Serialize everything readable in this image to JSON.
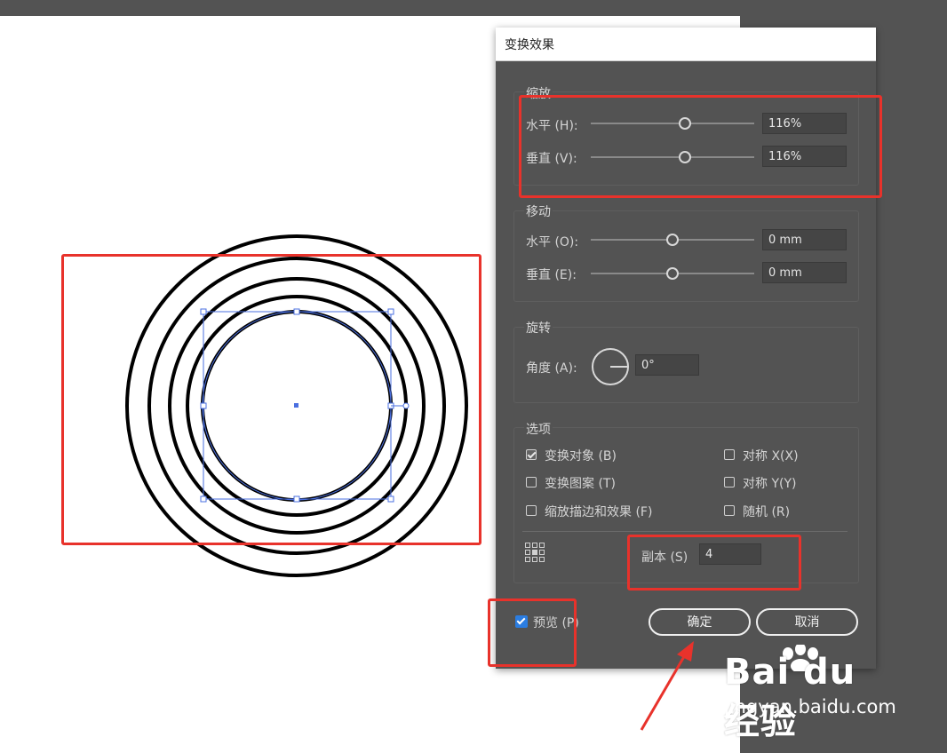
{
  "dialog": {
    "title": "变换效果",
    "scale": {
      "title": "缩放",
      "horizontal": {
        "label": "水平 (H):",
        "value": "116%",
        "level": 0.57
      },
      "vertical": {
        "label": "垂直 (V):",
        "value": "116%",
        "level": 0.57
      }
    },
    "move": {
      "title": "移动",
      "horizontal": {
        "label": "水平 (O):",
        "value": "0 mm",
        "level": 0.5
      },
      "vertical": {
        "label": "垂直 (E):",
        "value": "0 mm",
        "level": 0.5
      }
    },
    "rotate": {
      "title": "旋转",
      "angle_label": "角度 (A):",
      "angle_value": "0°"
    },
    "options": {
      "title": "选项",
      "transform_objects": {
        "label": "变换对象 (B)",
        "checked": true
      },
      "transform_patterns": {
        "label": "变换图案 (T)",
        "checked": false
      },
      "scale_strokes": {
        "label": "缩放描边和效果 (F)",
        "checked": false
      },
      "reflect_x": {
        "label": "对称 X(X)",
        "checked": false
      },
      "reflect_y": {
        "label": "对称 Y(Y)",
        "checked": false
      },
      "random": {
        "label": "随机 (R)",
        "checked": false
      },
      "copies_label": "副本 (S)",
      "copies_value": "4"
    },
    "preview": {
      "label": "预览 (P)",
      "checked": true
    },
    "ok_label": "确定",
    "cancel_label": "取消"
  },
  "watermark": {
    "logo": "Bai du 经验",
    "url": "jingyan.baidu.com"
  },
  "colors": {
    "annotation": "#e8322b",
    "selection": "#4a6fe0",
    "panel": "#535353"
  }
}
